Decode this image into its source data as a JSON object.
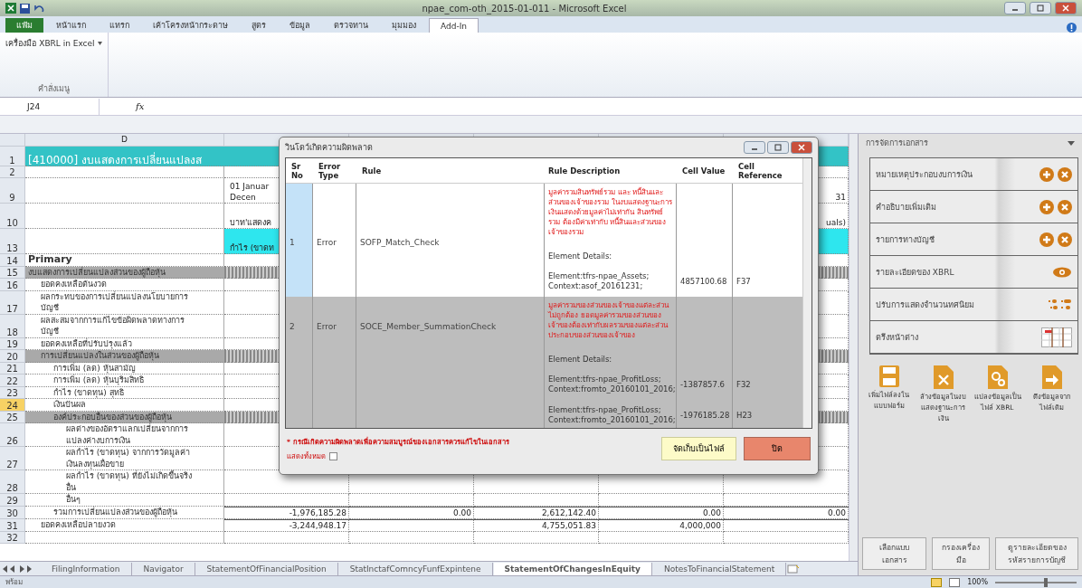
{
  "window": {
    "title": "npae_com-oth_2015-01-011 - Microsoft Excel"
  },
  "ribbon": {
    "tabs": [
      {
        "label": "แฟ้ม",
        "kind": "file",
        "selected": false
      },
      {
        "label": "หน้าแรก",
        "kind": "tab",
        "selected": false
      },
      {
        "label": "แทรก",
        "kind": "tab",
        "selected": false
      },
      {
        "label": "เค้าโครงหน้ากระดาษ",
        "kind": "tab",
        "selected": false
      },
      {
        "label": "สูตร",
        "kind": "tab",
        "selected": false
      },
      {
        "label": "ข้อมูล",
        "kind": "tab",
        "selected": false
      },
      {
        "label": "ตรวจทาน",
        "kind": "tab",
        "selected": false
      },
      {
        "label": "มุมมอง",
        "kind": "tab",
        "selected": false
      },
      {
        "label": "Add-In",
        "kind": "tab",
        "selected": true
      }
    ],
    "command": "เครื่องมือ XBRL in Excel",
    "group_label": "คำสั่งเมนู"
  },
  "formula_bar": {
    "name_box": "J24",
    "formula_label": "fx"
  },
  "sheet": {
    "column_header": "D",
    "rows": [
      {
        "number": "1",
        "kind": "title",
        "label": "[410000] งบแสดงการเปลี่ยนแปลงส",
        "active": false
      },
      {
        "number": "2",
        "kind": "blank",
        "active": false
      },
      {
        "number": "9",
        "kind": "period",
        "cells": [
          "01 Januar\nDecen",
          "",
          "",
          "",
          "31"
        ],
        "active": false
      },
      {
        "number": "10",
        "kind": "period",
        "cells": [
          "บาท'แสดงค",
          "",
          "",
          "",
          "uals)"
        ],
        "active": false
      },
      {
        "number": "13",
        "kind": "column-header",
        "cells": [
          "กำไร (ขาดท",
          "",
          "",
          "",
          ""
        ],
        "active": false
      },
      {
        "number": "14",
        "kind": "heading",
        "label": "Primary",
        "active": false
      },
      {
        "number": "15",
        "kind": "section",
        "label": "งบแสดงการเปลี่ยนแปลงส่วนของผู้ถือหุ้น",
        "active": false,
        "children": [
          {
            "number": "16",
            "kind": "item",
            "label": "ยอดคงเหลือต้นงวด",
            "active": false
          },
          {
            "number": "17",
            "kind": "item",
            "label": "ผลกระทบของการเปลี่ยนแปลงนโยบายการบัญชี",
            "active": false
          },
          {
            "number": "18",
            "kind": "item",
            "label": "ผลสะสมจากการแก้ไขข้อผิดพลาดทางการบัญชี",
            "active": false
          },
          {
            "number": "19",
            "kind": "item",
            "label": "ยอดคงเหลือที่ปรับปรุงแล้ว",
            "active": false
          },
          {
            "number": "20",
            "kind": "section",
            "label": "การเปลี่ยนแปลงในส่วนของผู้ถือหุ้น",
            "active": false,
            "children": [
              {
                "number": "21",
                "kind": "item",
                "label": "การเพิ่ม (ลด) หุ้นสามัญ",
                "active": false
              },
              {
                "number": "22",
                "kind": "item",
                "label": "การเพิ่ม (ลด) หุ้นบุริมสิทธิ",
                "active": false
              },
              {
                "number": "23",
                "kind": "item",
                "label": "กำไร (ขาดทุน) สุทธิ",
                "active": false
              },
              {
                "number": "24",
                "kind": "item",
                "label": "เงินปันผล",
                "active": true
              },
              {
                "number": "25",
                "kind": "section",
                "label": "องค์ประกอบอื่นของส่วนของผู้ถือหุ้น",
                "active": false,
                "children": [
                  {
                    "number": "26",
                    "kind": "item",
                    "label": "ผลต่างของอัตราแลกเปลี่ยนจากการแปลงค่างบการเงิน",
                    "active": false
                  },
                  {
                    "number": "27",
                    "kind": "item",
                    "label": "ผลกำไร (ขาดทุน) จากการวัดมูลค่าเงินลงทุนเผื่อขาย",
                    "active": false
                  },
                  {
                    "number": "28",
                    "kind": "item",
                    "label": "ผลกำไร (ขาดทุน) ที่ยังไม่เกิดขึ้นจริงอื่น",
                    "active": false
                  },
                  {
                    "number": "29",
                    "kind": "item",
                    "label": "อื่นๆ",
                    "active": false
                  }
                ]
              },
              {
                "number": "30",
                "kind": "total",
                "label": "รวมการเปลี่ยนแปลงส่วนของผู้ถือหุ้น",
                "cells": [
                  "-1,976,185.28",
                  "0.00",
                  "2,612,142.40",
                  "0.00",
                  "0.00"
                ],
                "active": false
              }
            ]
          },
          {
            "number": "31",
            "kind": "total",
            "label": "ยอดคงเหลือปลายงวด",
            "cells": [
              "-3,244,948.17",
              "",
              "4,755,051.83",
              "4,000,000",
              ""
            ],
            "active": false
          }
        ]
      },
      {
        "number": "32",
        "kind": "blank",
        "active": false
      }
    ],
    "tabs": [
      {
        "label": "FilingInformation",
        "selected": false
      },
      {
        "label": "Navigator",
        "selected": false
      },
      {
        "label": "StatementOfFinancialPosition",
        "selected": false
      },
      {
        "label": "StatInctafComncyFunfExpintene",
        "selected": false
      },
      {
        "label": "StatementOfChangesInEquity",
        "selected": true
      },
      {
        "label": "NotesToFinancialStatement",
        "selected": false
      }
    ]
  },
  "dialog": {
    "title": "วินโดว์เกิดความผิดพลาด",
    "columns": [
      [
        "Sr",
        "No"
      ],
      [
        "Error",
        "Type"
      ],
      [
        "Rule"
      ],
      [
        "Rule Description"
      ],
      [
        "Cell Value"
      ],
      [
        "Cell",
        "Reference"
      ]
    ],
    "rows": [
      {
        "sr": "1",
        "type": "Error",
        "rule": "SOFP_Match_Check",
        "selected": true,
        "description": "มูลค่ารวมสินทรัพย์รวม และ หนี้สินและส่วนของเจ้าของรวม ในงบแสดงฐานะการเงินแสดงด้วยมูลค่าไม่เท่ากัน สินทรัพย์รวม ต้องมีค่าเท่ากับ หนี้สินและส่วนของเจ้าของรวม",
        "details_label": "Element Details:",
        "elements": [
          {
            "lines": [
              "Element:tfrs-npae_Assets;",
              "Context:asof_20161231;"
            ],
            "value": "4857100.68",
            "reference": "F37"
          }
        ]
      },
      {
        "sr": "2",
        "type": "Error",
        "rule": "SOCE_Member_SummationCheck",
        "selected": false,
        "description": "มูลค่ารวมของส่วนของเจ้าของแต่ละส่วนไม่ถูกต้อง ยอดมูลค่ารวมของส่วนของเจ้าของต้องเท่ากับผลรวมของแต่ละส่วนประกอบของส่วนของเจ้าของ",
        "details_label": "Element Details:",
        "elements": [
          {
            "lines": [
              "Element:tfrs-npae_ProfitLoss;",
              "Context:fromto_20160101_2016;"
            ],
            "value": "-1387857.6",
            "reference": "F32"
          },
          {
            "lines": [
              "Element:tfrs-npae_ProfitLoss;",
              "Context:fromto_20160101_2016;"
            ],
            "value": "-1976185.28",
            "reference": "H23"
          }
        ]
      }
    ],
    "note": "* กรณีเกิดความผิดพลาดเพื่อความสมบูรณ์ของเอกสารควรแก้ไขในเอกสาร",
    "show_all": {
      "label": "แสดงทั้งหมด",
      "checked": false
    },
    "buttons": [
      {
        "label": "จัดเก็บเป็นไฟล์",
        "kind": "save"
      },
      {
        "label": "ปิด",
        "kind": "close"
      }
    ]
  },
  "task_pane": {
    "title": "การจัดการเอกสาร",
    "items": [
      {
        "label": "หมายเหตุประกอบงบการเงิน",
        "kind": "add-remove"
      },
      {
        "label": "คำอธิบายเพิ่มเติม",
        "kind": "add-remove"
      },
      {
        "label": "รายการทางบัญชี",
        "kind": "add-remove"
      },
      {
        "label": "รายละเอียดของ XBRL",
        "kind": "view"
      },
      {
        "label": "ปรับการแสดงจำนวนทศนิยม",
        "kind": "decimals"
      },
      {
        "label": "ตรึงหน้าต่าง",
        "kind": "freeze"
      }
    ],
    "actions": [
      {
        "label": "เพิ่มไฟล์ลงในแบบฟอร์ม",
        "kind": "save"
      },
      {
        "label": "ล้างข้อมูลในงบแสดงฐานะการเงิน",
        "kind": "delete"
      },
      {
        "label": "แปลงข้อมูลเป็นไฟล์ XBRL",
        "kind": "convert"
      },
      {
        "label": "ดึงข้อมูลจากไฟล์เดิม",
        "kind": "import"
      }
    ],
    "buttons": [
      "เลือกแบบเอกสาร",
      "กรองเครื่องมือ",
      "ดูรายละเอียดของรหัสรายการบัญชี"
    ]
  },
  "status_bar": {
    "text": "พร้อม",
    "zoom": "100%",
    "level": 0.6
  }
}
